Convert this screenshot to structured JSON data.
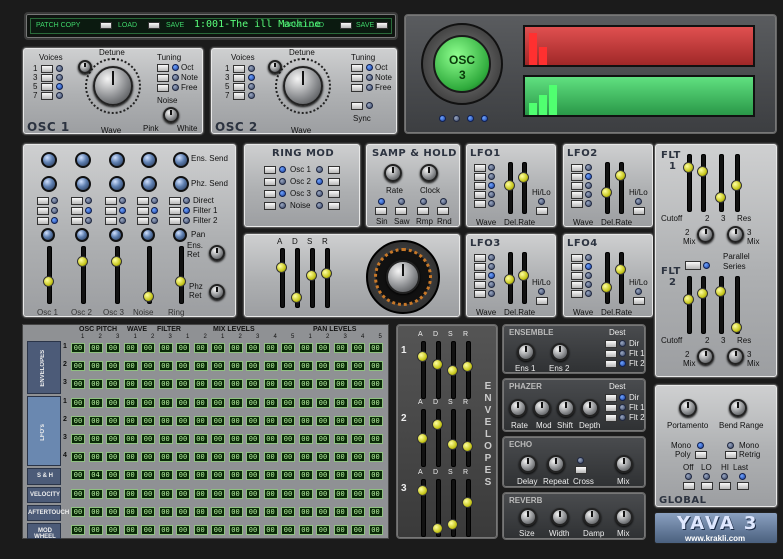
{
  "topbar": {
    "patch_copy": "PATCH COPY",
    "load": "LOAD",
    "save": "SAVE",
    "patch_name": "1:001-The ill Machine",
    "bank_load": "BANK LOAD",
    "bank_save": "SAVE"
  },
  "osc1": {
    "title": "OSC 1",
    "voices": "Voices",
    "voice_nums": [
      "1",
      "3",
      "5",
      "7"
    ],
    "detune": "Detune",
    "wave": "Wave",
    "tuning": "Tuning",
    "oct": "Oct",
    "note": "Note",
    "free": "Free",
    "noise": "Noise",
    "pink": "Pink",
    "white": "White"
  },
  "osc2": {
    "title": "OSC 2",
    "voices": "Voices",
    "voice_nums": [
      "1",
      "3",
      "5",
      "7"
    ],
    "detune": "Detune",
    "wave": "Wave",
    "tuning": "Tuning",
    "oct": "Oct",
    "note": "Note",
    "free": "Free",
    "sync": "Sync"
  },
  "scope": {
    "label": "OSC",
    "number": "3"
  },
  "mixer": {
    "ens_send": "Ens. Send",
    "phz_send": "Phz. Send",
    "direct": "Direct",
    "filter1": "Filter 1",
    "filter2": "Filter 2",
    "pan": "Pan",
    "ens_ret": "Ens.\nRet",
    "phz_ret": "Phz\nRet",
    "channels": [
      "Osc 1",
      "Osc 2",
      "Osc 3",
      "Noise",
      "Ring"
    ]
  },
  "ringmod": {
    "title": "RING MOD",
    "items": [
      "Osc 1",
      "Osc 2",
      "Osc 3",
      "Noise"
    ]
  },
  "samphold": {
    "title": "SAMP & HOLD",
    "rate": "Rate",
    "clock": "Clock",
    "buttons": [
      "Sin",
      "Saw",
      "Rmp",
      "Rnd"
    ]
  },
  "lfos": [
    {
      "title": "LFO1"
    },
    {
      "title": "LFO2"
    },
    {
      "title": "LFO3"
    },
    {
      "title": "LFO4"
    }
  ],
  "lfo_labels": {
    "wave": "Wave",
    "delrate": "Del.Rate",
    "hilo": "Hi/Lo"
  },
  "adsr": [
    "A",
    "D",
    "S",
    "R"
  ],
  "flt": {
    "flt1": "FLT\n1",
    "flt2": "FLT\n2",
    "cutoff": "Cutoff",
    "two": "2",
    "three": "3",
    "res": "Res",
    "mix": "Mix",
    "parallel": "Parallel",
    "series": "Series"
  },
  "matrix": {
    "headers": [
      "OSC PITCH",
      "WAVE",
      "FILTER",
      "MIX LEVELS",
      "PAN LEVELS"
    ],
    "col_nums": [
      "1",
      "2",
      "3",
      "1",
      "2",
      "3",
      "1",
      "2",
      "1",
      "2",
      "3",
      "4",
      "5",
      "1",
      "2",
      "3",
      "4",
      "5"
    ],
    "groups": [
      "ENVELOPES",
      "LFO's",
      "S & H",
      "VELOCITY",
      "AFTERTOUCH",
      "MOD WHEEL"
    ],
    "row_nums": [
      "1",
      "2",
      "3",
      "1",
      "2",
      "3",
      "4"
    ],
    "sh_row": [
      "00",
      "04",
      "00",
      "00",
      "00",
      "00",
      "00",
      "00",
      "00",
      "00",
      "00",
      "00",
      "00",
      "00",
      "00",
      "00",
      "00",
      "00"
    ],
    "cell_value": "00"
  },
  "envelopes": {
    "title": "ENVELOPES",
    "nums": [
      "1",
      "2",
      "3"
    ]
  },
  "ensemble": {
    "title": "ENSEMBLE",
    "dest": "Dest",
    "ens1": "Ens 1",
    "ens2": "Ens 2",
    "dests": [
      "Dir",
      "Flt 1",
      "Flt 2"
    ]
  },
  "phazer": {
    "title": "PHAZER",
    "dest": "Dest",
    "knobs": [
      "Rate",
      "Mod",
      "Shift",
      "Depth"
    ],
    "dests": [
      "Dir",
      "Flt 1",
      "Flt 2"
    ]
  },
  "echo": {
    "title": "ECHO",
    "knobs": [
      "Delay",
      "Repeat",
      "Cross",
      "Mix"
    ]
  },
  "reverb": {
    "title": "REVERB",
    "knobs": [
      "Size",
      "Width",
      "Damp",
      "Mix"
    ]
  },
  "global": {
    "title": "GLOBAL",
    "portamento": "Portamento",
    "bend": "Bend Range",
    "mono": "Mono",
    "poly": "Poly",
    "mono2": "Mono",
    "retrig": "Retrig",
    "off": "Off",
    "lo": "LO",
    "hi": "HI",
    "last": "Last"
  },
  "brand": {
    "name": "YAVA 3",
    "url": "www.krakli.com"
  },
  "colors": {
    "panel": "#b0b2b4",
    "led_blue": "#3b6fe0",
    "fader_yellow": "#e6e63a",
    "display_green": "#3ec26a",
    "display_red": "#c23c3c",
    "matrix_cell": "#0a2a08"
  }
}
